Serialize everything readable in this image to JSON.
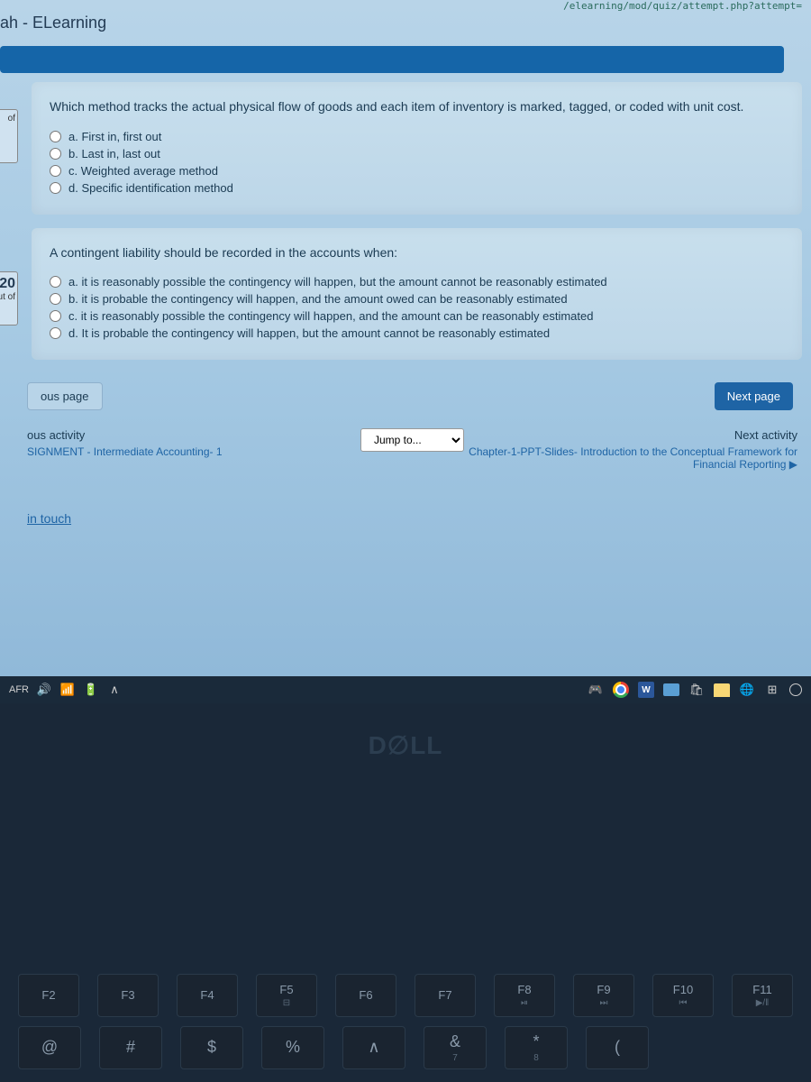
{
  "url_fragment": "/elearning/mod/quiz/attempt.php?attempt=",
  "site_title": "ah - ELearning",
  "q1": {
    "side_label": "of",
    "text": "Which method tracks the actual physical flow of goods and each item of inventory is marked, tagged, or coded with unit cost.",
    "options": [
      "a. First in, first out",
      "b. Last in, last out",
      "c. Weighted average method",
      "d. Specific identification method"
    ]
  },
  "q2": {
    "number": "20",
    "side_label": "ut of",
    "text": "A contingent liability should be recorded in the accounts when:",
    "options": [
      "a. it is reasonably possible the contingency will happen, but the amount cannot be reasonably estimated",
      "b. it is probable the contingency will happen, and the amount owed can be reasonably estimated",
      "c. it is reasonably possible the contingency will happen, and the amount can be reasonably estimated",
      "d. It is probable the contingency will happen, but the amount cannot be reasonably estimated"
    ]
  },
  "nav": {
    "prev": "ous page",
    "next": "Next page"
  },
  "activity": {
    "prev_header": "ous activity",
    "prev_link": "SIGNMENT - Intermediate Accounting- 1",
    "jump": "Jump to...",
    "next_header": "Next activity",
    "next_link": "Chapter-1-PPT-Slides- Introduction to the Conceptual Framework for Financial Reporting ▶"
  },
  "footer_link": "in touch",
  "taskbar": {
    "lang": "AFR",
    "word": "W"
  },
  "dell": "D∅LL",
  "keys_row1": [
    "F2",
    "F3",
    "F4",
    "F5",
    "F6",
    "F7",
    "F8",
    "F9",
    "F10",
    "F11"
  ],
  "keys_row1_sub": [
    "",
    "",
    "",
    "⊟",
    "",
    "",
    "⏯",
    "⏭",
    "⏮",
    "▶/‖"
  ],
  "keys_row2_top": [
    "@",
    "#",
    "$",
    "%",
    "∧",
    "&",
    "*",
    "("
  ],
  "keys_row2_bot": [
    "",
    "",
    "",
    "",
    "",
    "7",
    "8",
    ""
  ]
}
